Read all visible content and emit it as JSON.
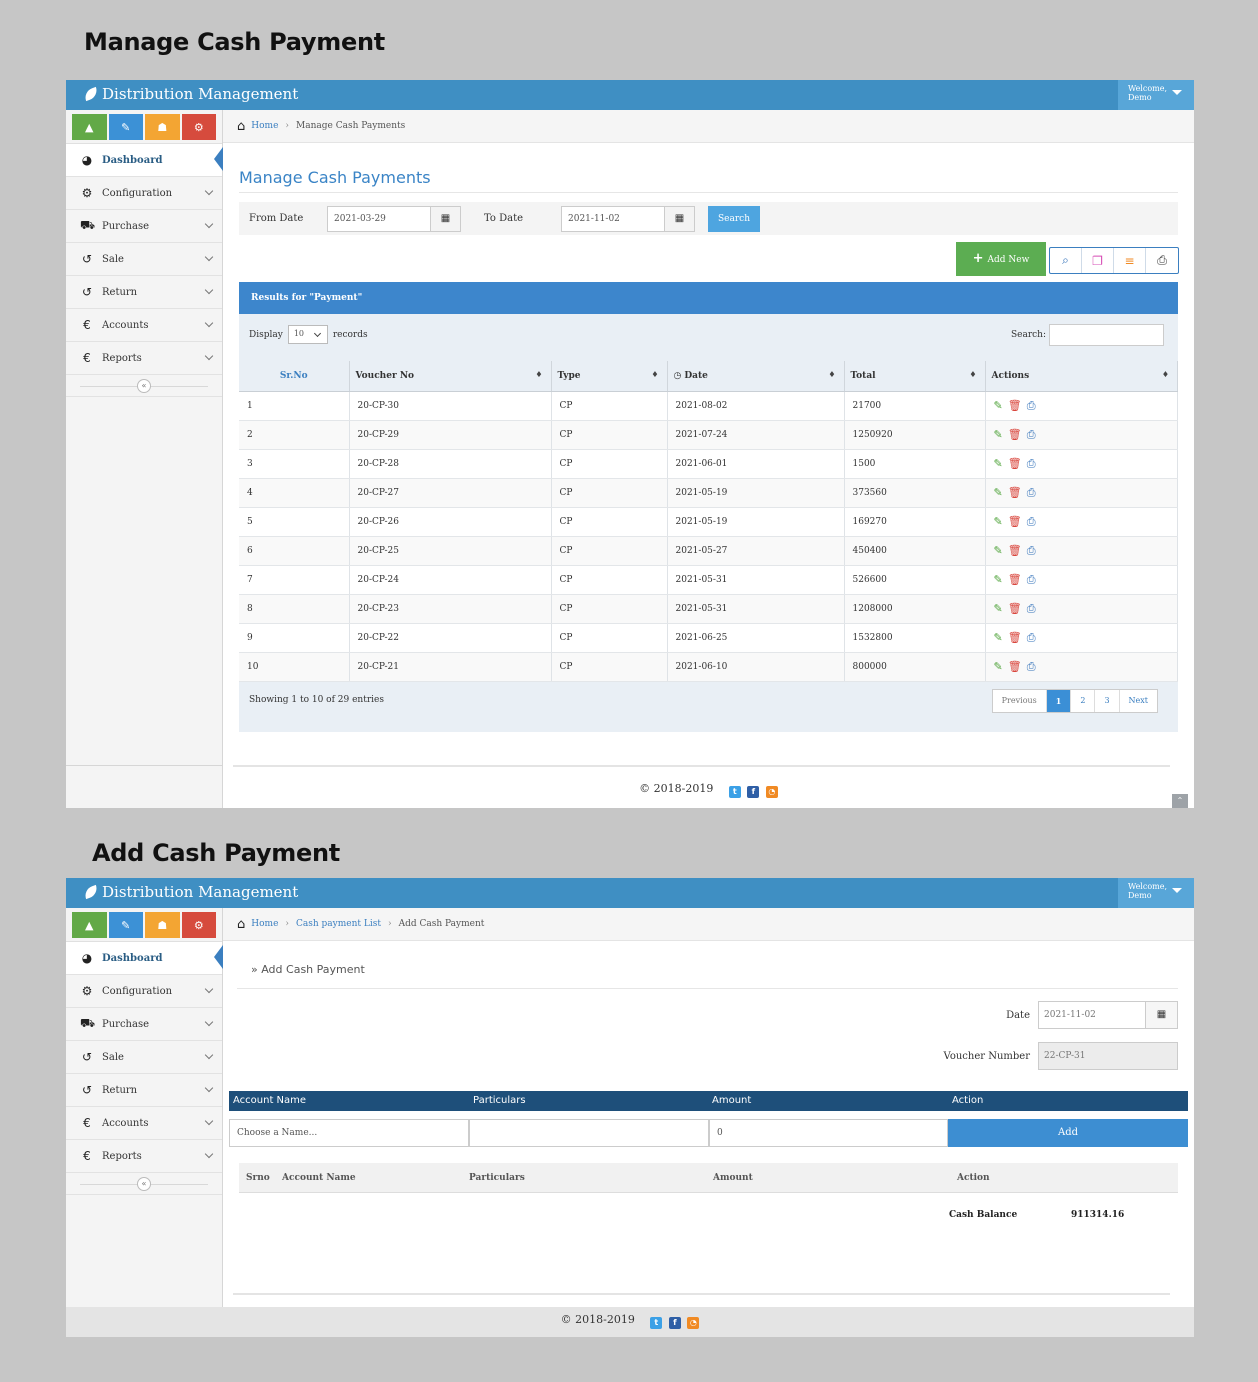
{
  "headings": {
    "manage": "Manage Cash Payment",
    "add": "Add Cash Payment"
  },
  "app": {
    "brand": "Distribution Management",
    "welcome": "Welcome,",
    "user": "Demo"
  },
  "colors": {
    "topbar": "#3f8fc3",
    "accent": "#3d86cc",
    "success": "#5cad52",
    "navy": "#1e4f7a"
  },
  "sidebar": {
    "shortcuts": [
      {
        "icon": "chart-icon",
        "glyph": "▲",
        "color": "#62a947"
      },
      {
        "icon": "pencil-icon",
        "glyph": "✎",
        "color": "#3c91d6"
      },
      {
        "icon": "users-icon",
        "glyph": "☗",
        "color": "#f3a533"
      },
      {
        "icon": "cogs-icon",
        "glyph": "⚙",
        "color": "#d64b3d"
      }
    ],
    "items": [
      {
        "label": "Dashboard",
        "icon": "dashboard-icon",
        "glyph": "◕"
      },
      {
        "label": "Configuration",
        "icon": "cogs-icon",
        "glyph": "⚙"
      },
      {
        "label": "Purchase",
        "icon": "cart-icon",
        "glyph": "⛟"
      },
      {
        "label": "Sale",
        "icon": "undo-icon",
        "glyph": "↺"
      },
      {
        "label": "Return",
        "icon": "undo-icon",
        "glyph": "↺"
      },
      {
        "label": "Accounts",
        "icon": "euro-icon",
        "glyph": "€"
      },
      {
        "label": "Reports",
        "icon": "euro-icon",
        "glyph": "€"
      }
    ],
    "collapse_glyph": "«"
  },
  "manage": {
    "breadcrumb": {
      "home": "Home",
      "current": "Manage Cash Payments"
    },
    "title": "Manage Cash Payments",
    "filter": {
      "from_label": "From Date",
      "from_value": "2021-03-29",
      "to_label": "To Date",
      "to_value": "2021-11-02",
      "search": "Search"
    },
    "add_new": "Add New",
    "results_title": "Results for \"Payment\"",
    "display": "Display",
    "page_len": "10",
    "records": "records",
    "search_label": "Search:",
    "columns": [
      "Sr.No",
      "Voucher No",
      "Type",
      "Date",
      "Total",
      "Actions"
    ],
    "rows": [
      [
        "1",
        "20-CP-30",
        "CP",
        "2021-08-02",
        "21700"
      ],
      [
        "2",
        "20-CP-29",
        "CP",
        "2021-07-24",
        "1250920"
      ],
      [
        "3",
        "20-CP-28",
        "CP",
        "2021-06-01",
        "1500"
      ],
      [
        "4",
        "20-CP-27",
        "CP",
        "2021-05-19",
        "373560"
      ],
      [
        "5",
        "20-CP-26",
        "CP",
        "2021-05-19",
        "169270"
      ],
      [
        "6",
        "20-CP-25",
        "CP",
        "2021-05-27",
        "450400"
      ],
      [
        "7",
        "20-CP-24",
        "CP",
        "2021-05-31",
        "526600"
      ],
      [
        "8",
        "20-CP-23",
        "CP",
        "2021-05-31",
        "1208000"
      ],
      [
        "9",
        "20-CP-22",
        "CP",
        "2021-06-25",
        "1532800"
      ],
      [
        "10",
        "20-CP-21",
        "CP",
        "2021-06-10",
        "800000"
      ]
    ],
    "showing": "Showing 1 to 10 of 29 entries",
    "pager": [
      "Previous",
      "1",
      "2",
      "3",
      "Next"
    ]
  },
  "add": {
    "breadcrumb": {
      "home": "Home",
      "list": "Cash payment List",
      "current": "Add Cash Payment"
    },
    "subtitle": "» Add Cash Payment",
    "date_label": "Date",
    "date_value": "2021-11-02",
    "voucher_label": "Voucher Number",
    "voucher_value": "22-CP-31",
    "line_columns": [
      "Account Name",
      "Particulars",
      "Amount",
      "Action"
    ],
    "account_placeholder": "Choose a Name...",
    "amount_value": "0",
    "add_button": "Add",
    "entry_columns": [
      "Srno",
      "Account Name",
      "Particulars",
      "Amount",
      "Action"
    ],
    "balance_label": "Cash Balance",
    "balance_value": "911314.16"
  },
  "footer": {
    "copyright": "© 2018-2019"
  }
}
